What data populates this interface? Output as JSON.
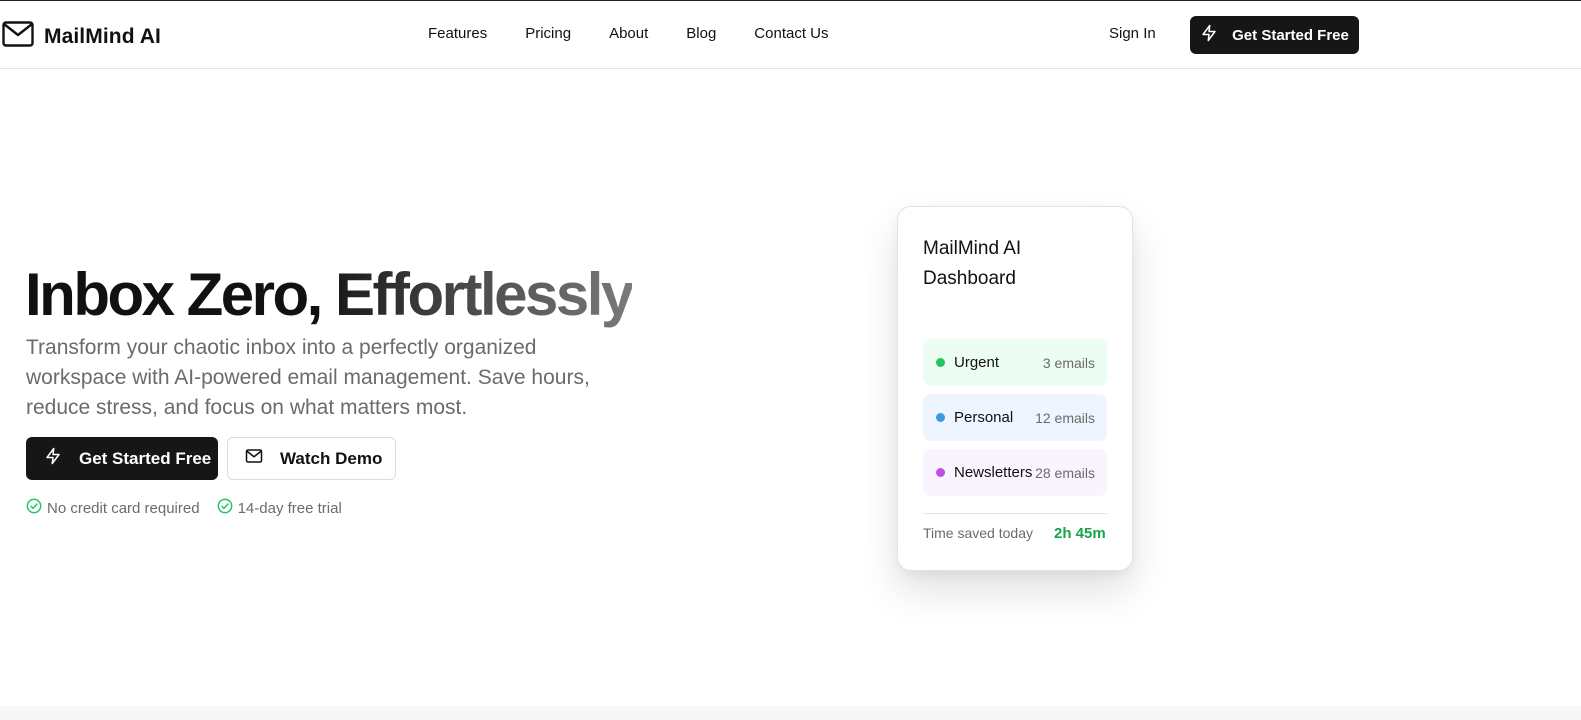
{
  "brand": {
    "name": "MailMind AI",
    "icon": "mail-icon"
  },
  "nav": {
    "items": [
      "Features",
      "Pricing",
      "About",
      "Blog",
      "Contact Us"
    ],
    "sign_in": "Sign In",
    "cta": "Get Started Free"
  },
  "hero": {
    "title_part1": "Inbox Zero,",
    "title_part2": "Effortlessly",
    "subtitle": "Transform your chaotic inbox into a perfectly organized workspace with AI-powered email management. Save hours, reduce stress, and focus on what matters most.",
    "primary_button": "Get Started Free",
    "secondary_button": "Watch Demo",
    "perks": [
      "No credit card required",
      "14-day free trial"
    ]
  },
  "dashboard": {
    "title": "MailMind AI Dashboard",
    "categories": [
      {
        "label": "Urgent",
        "count": "3 emails",
        "dot_color": "#22c55e",
        "bg_color": "#ecfdf3"
      },
      {
        "label": "Personal",
        "count": "12 emails",
        "dot_color": "#3b9ae1",
        "bg_color": "#eef5fe"
      },
      {
        "label": "Newsletters",
        "count": "28 emails",
        "dot_color": "#c04ee6",
        "bg_color": "#faf4fe"
      }
    ],
    "time_saved_label": "Time saved today",
    "time_saved_value": "2h 45m"
  },
  "colors": {
    "primary": "#161616",
    "accent_green": "#16a34a",
    "muted_text": "#6b6b6b"
  }
}
